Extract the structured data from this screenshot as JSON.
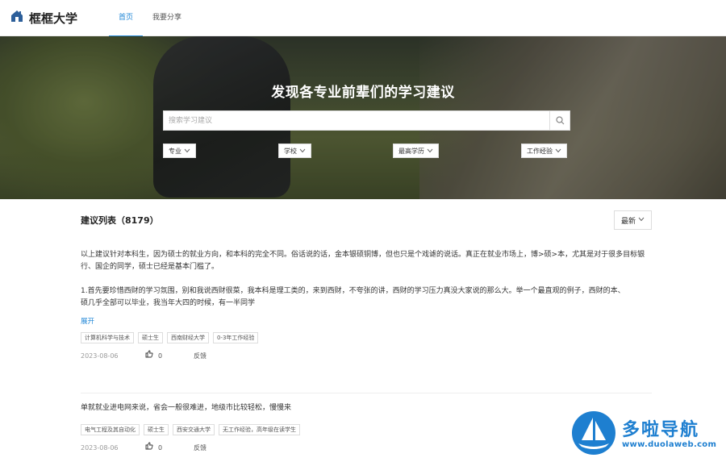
{
  "header": {
    "logo_text": "框框大学",
    "nav": [
      {
        "label": "首页",
        "active": true
      },
      {
        "label": "我要分享",
        "active": false
      }
    ]
  },
  "hero": {
    "title": "发现各专业前辈们的学习建议",
    "search_placeholder": "搜索学习建议",
    "filters": [
      "专业",
      "学校",
      "最高学历",
      "工作经验"
    ]
  },
  "list": {
    "title": "建议列表（8179）",
    "sort_label": "最新",
    "posts": [
      {
        "paragraphs": [
          "以上建议针对本科生，因为硕士的就业方向，和本科的完全不同。俗话说的话，金本银硕铜博，但也只是个戏谑的说话。真正在就业市场上，博>硕>本，尤其是对于很多目标银行、国企的同学，硕士已经是基本门槛了。",
          "",
          "1.首先要珍惜西财的学习氛围，别和我说西财很菜，我本科是理工类的，来到西财，不夸张的讲，西财的学习压力真没大家说的那么大。举一个最直观的例子，西财的本、",
          "硕几乎全部可以毕业，我当年大四的时候，有一半同学"
        ],
        "expand_label": "展开",
        "tags": [
          "计算机科学与技术",
          "硕士生",
          "西南财经大学",
          "0-3年工作经验"
        ],
        "date": "2023-08-06",
        "likes": "0",
        "report_label": "反馈"
      },
      {
        "paragraphs": [
          "单就就业进电网来说，省会一般很难进，地级市比较轻松，慢慢来"
        ],
        "tags": [
          "电气工程及其自动化",
          "硕士生",
          "西安交通大学",
          "无工作经验，高年级在读学生"
        ],
        "date": "2023-08-06",
        "likes": "0",
        "report_label": "反馈"
      }
    ]
  },
  "watermark": {
    "main": "多啦导航",
    "sub": "www.duolaweb.com"
  },
  "colors": {
    "accent": "#1f86d6",
    "watermark": "#1e7fd0"
  }
}
